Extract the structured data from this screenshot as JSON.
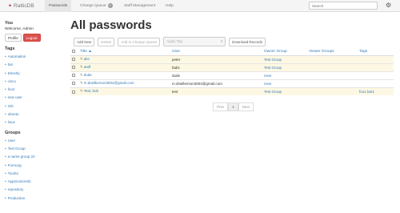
{
  "navbar": {
    "brand": "RatticDB",
    "items": [
      {
        "label": "Passwords",
        "active": true
      },
      {
        "label": "Change Queue",
        "badge": "0"
      },
      {
        "label": "Staff Management"
      },
      {
        "label": "Help"
      }
    ],
    "search_placeholder": "Search"
  },
  "sidebar": {
    "you_heading": "You",
    "welcome": "Welcome, Admin",
    "profile_label": "Profile",
    "logout_label": "Logout",
    "tags_heading": "Tags",
    "tags": [
      "Automation",
      "bar",
      "Directly",
      "cisco",
      "foo2",
      "new user",
      "rish",
      "ubuntu",
      "linux"
    ],
    "groups_heading": "Groups",
    "groups": [
      "User",
      "Test Group",
      "a name group 22",
      "Formorg",
      "Tourks",
      "Appsrootcred1",
      "repository",
      "Production"
    ]
  },
  "main": {
    "title": "All passwords",
    "toolbar": {
      "add_new": "Add New",
      "delete": "Delete",
      "add_to_change_queue": "Add to Change Queue",
      "apply_tag": "Apply Tag",
      "download_records": "Download Records"
    },
    "table": {
      "headers": {
        "title": "Title ▲",
        "user": "User",
        "owner_group": "Owner Group",
        "viewer_groups": "Viewer Groups",
        "tags": "Tags"
      },
      "rows": [
        {
          "title": "abc",
          "user": "peter",
          "owner": "Test Group",
          "viewers": "",
          "tags": ""
        },
        {
          "title": "asdf",
          "user": "fadsi",
          "owner": "Test Group",
          "viewers": "",
          "tags": ""
        },
        {
          "title": "dude",
          "user": "dude",
          "owner": "User",
          "viewers": "",
          "tags": ""
        },
        {
          "title": "m.drwilkerson3004@gmail.com",
          "user": "m.drwilkerson3004@gmail.com",
          "owner": "User",
          "viewers": "",
          "tags": ""
        },
        {
          "title": "Test, bob",
          "user": "test",
          "owner": "Test Group",
          "viewers": "",
          "tags": "foo1 bar1"
        }
      ]
    },
    "pager": {
      "prev": "Prev",
      "page": "1",
      "next": "Next"
    }
  }
}
